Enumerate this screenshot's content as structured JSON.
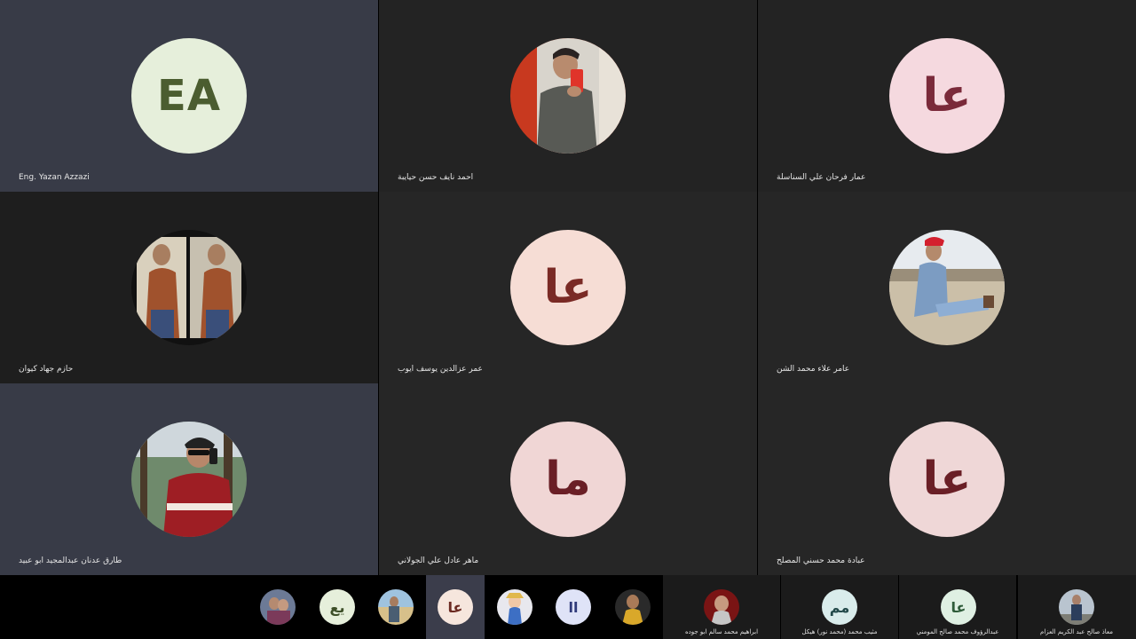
{
  "tiles": [
    {
      "name": "Eng. Yazan Azzazi",
      "initials": "EA",
      "bg": "#383b47",
      "avatar_bg": "#e6efdb",
      "avatar_fg": "#4b5d30"
    },
    {
      "name": "احمد نايف حسن حيايبة",
      "bg": "#232323",
      "photo": "man-red-background-icon"
    },
    {
      "name": "عمار فرحان علي السناسلة",
      "initials": "عا",
      "bg": "#232323",
      "avatar_bg": "#f5d9df",
      "avatar_fg": "#7a2a3a"
    },
    {
      "name": "حازم جهاد كيوان",
      "bg": "#1e1e1e",
      "photo": "two-men-collage-icon"
    },
    {
      "name": "عمر عزالدين يوسف ايوب",
      "initials": "عا",
      "bg": "#262626",
      "avatar_bg": "#f6ddd5",
      "avatar_fg": "#7a2a25"
    },
    {
      "name": "عامر علاء محمد الشن",
      "bg": "#262626",
      "photo": "man-sitting-outdoors-icon"
    },
    {
      "name": "طارق عدنان عبدالمجيد ابو عبيد",
      "bg": "#383b47",
      "photo": "man-phone-red-sweater-icon"
    },
    {
      "name": "ماهر عادل علي الجولاني",
      "initials": "ما",
      "bg": "#262626",
      "avatar_bg": "#f0d6d5",
      "avatar_fg": "#6a1f26"
    },
    {
      "name": "عبادة محمد حسني المصلح",
      "initials": "عا",
      "bg": "#262626",
      "avatar_bg": "#efd7d7",
      "avatar_fg": "#6a1f26"
    }
  ],
  "strip": {
    "thumbs": [
      {
        "kind": "photo",
        "icon": "couple-photo-icon"
      },
      {
        "kind": "initials",
        "initials": "يع",
        "bg": "#e6efdb",
        "fg": "#3d4f28"
      },
      {
        "kind": "photo",
        "icon": "beach-photo-icon"
      },
      {
        "kind": "initials",
        "initials": "عا",
        "bg": "#f6e6dd",
        "fg": "#6b2a22",
        "active": true
      },
      {
        "kind": "photo",
        "icon": "anime-photo-icon"
      },
      {
        "kind": "initials",
        "initials": "اا",
        "bg": "#dfe3f7",
        "fg": "#303a7a"
      },
      {
        "kind": "photo",
        "icon": "yellow-shirt-photo-icon"
      }
    ],
    "named": [
      {
        "name": "ابراهيم محمد سالم ابو جوده",
        "icon": "man-red-photo-icon"
      },
      {
        "name": "مثيب محمد (محمد نور) هيكل",
        "initials": "مم",
        "bg": "#d9eceb",
        "fg": "#234a4a"
      },
      {
        "name": "عبدالرؤوف محمد صالح المومني",
        "initials": "عا",
        "bg": "#dff0e3",
        "fg": "#2f5c3a"
      },
      {
        "name": "معاذ صالح عبد الكريم العزام",
        "icon": "man-standing-photo-icon"
      }
    ]
  }
}
